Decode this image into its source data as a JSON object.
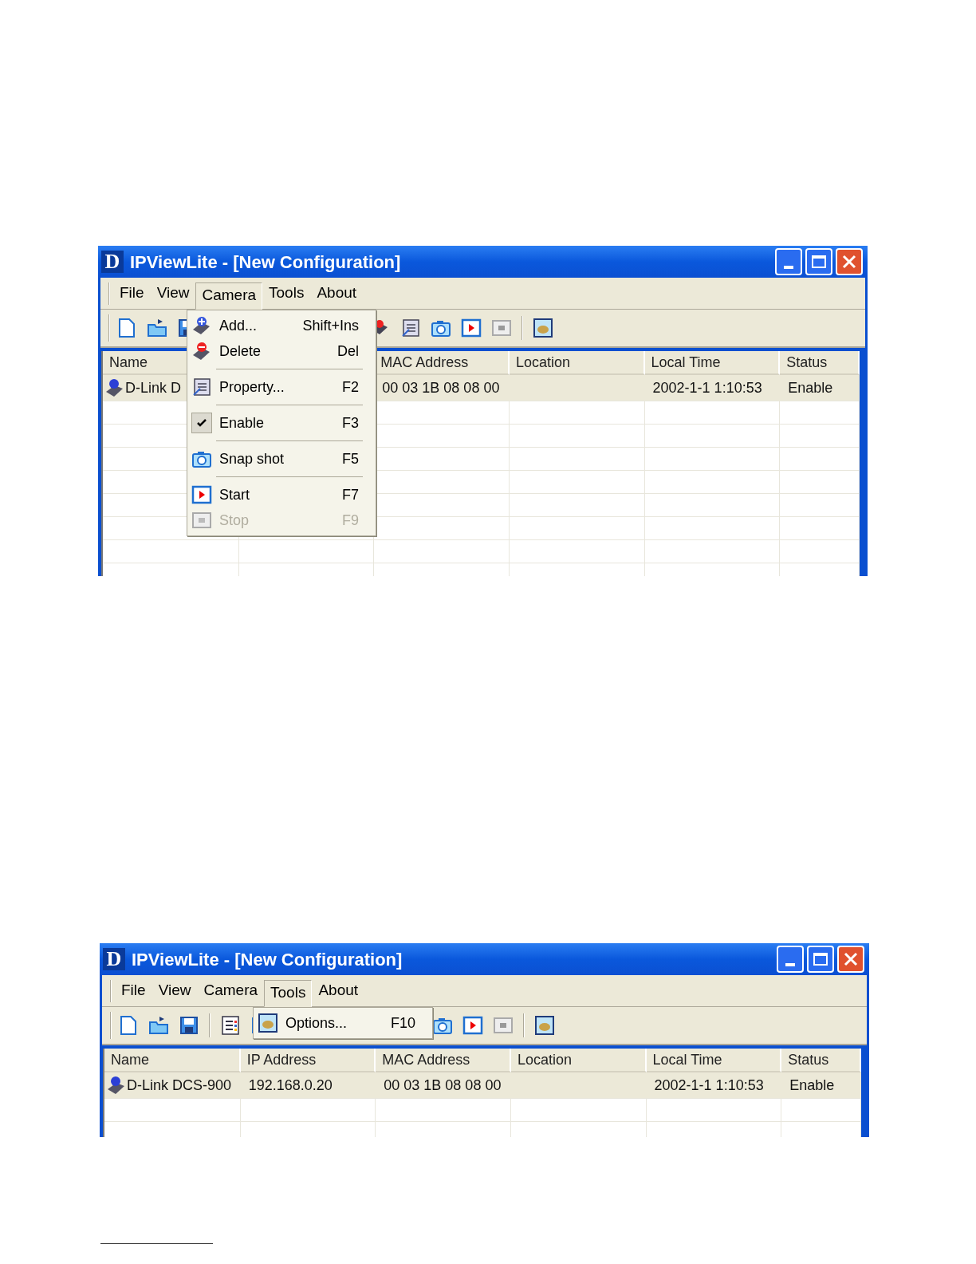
{
  "windows": [
    {
      "logo": "D",
      "title": "IPViewLite - [New Configuration]",
      "menu_bar": [
        {
          "label": "File",
          "selected": false
        },
        {
          "label": "View",
          "selected": false
        },
        {
          "label": "Camera",
          "selected": true
        },
        {
          "label": "Tools",
          "selected": false
        },
        {
          "label": "About",
          "selected": false
        }
      ],
      "toolbar": [
        {
          "kind": "new"
        },
        {
          "kind": "open"
        },
        {
          "kind": "save"
        },
        {
          "kind": "sep"
        },
        {
          "kind": "covered"
        },
        {
          "kind": "covered"
        },
        {
          "kind": "covered"
        },
        {
          "kind": "covered"
        },
        {
          "kind": "covered"
        },
        {
          "kind": "delete"
        },
        {
          "kind": "property"
        },
        {
          "kind": "snapshot"
        },
        {
          "kind": "start"
        },
        {
          "kind": "stop"
        },
        {
          "kind": "sep"
        },
        {
          "kind": "options"
        }
      ],
      "table": {
        "columns": [
          "Name",
          null,
          "MAC Address",
          "Location",
          "Local Time",
          "Status"
        ],
        "rows": [
          {
            "selected": true,
            "cells": [
              "D-Link D",
              null,
              "00 03 1B 08 08 00",
              null,
              "2002-1-1  1:10:53",
              "Enable"
            ]
          }
        ]
      },
      "menu": {
        "items": [
          {
            "kind": "add",
            "label": "Add...",
            "shortcut": "Shift+Ins",
            "checked": false,
            "disabled": false
          },
          {
            "kind": "delete",
            "label": "Delete",
            "shortcut": "Del",
            "checked": false,
            "disabled": false
          },
          {
            "kind": "separator"
          },
          {
            "kind": "property",
            "label": "Property...",
            "shortcut": "F2",
            "checked": false,
            "disabled": false
          },
          {
            "kind": "separator"
          },
          {
            "kind": "plain",
            "label": "Enable",
            "shortcut": "F3",
            "checked": true,
            "disabled": false
          },
          {
            "kind": "separator"
          },
          {
            "kind": "snapshot",
            "label": "Snap shot",
            "shortcut": "F5",
            "checked": false,
            "disabled": false
          },
          {
            "kind": "separator"
          },
          {
            "kind": "start",
            "label": "Start",
            "shortcut": "F7",
            "checked": false,
            "disabled": false
          },
          {
            "kind": "stop",
            "label": "Stop",
            "shortcut": "F9",
            "checked": false,
            "disabled": true
          }
        ]
      }
    },
    {
      "logo": "D",
      "title": "IPViewLite - [New Configuration]",
      "menu_bar": [
        {
          "label": "File",
          "selected": false
        },
        {
          "label": "View",
          "selected": false
        },
        {
          "label": "Camera",
          "selected": false
        },
        {
          "label": "Tools",
          "selected": true
        },
        {
          "label": "About",
          "selected": false
        }
      ],
      "toolbar": [
        {
          "kind": "new"
        },
        {
          "kind": "open"
        },
        {
          "kind": "save"
        },
        {
          "kind": "sep"
        },
        {
          "kind": "list"
        },
        {
          "kind": "window"
        },
        {
          "kind": "covered"
        },
        {
          "kind": "covered"
        },
        {
          "kind": "covered"
        },
        {
          "kind": "covered"
        },
        {
          "kind": "covered"
        },
        {
          "kind": "snapshot"
        },
        {
          "kind": "start"
        },
        {
          "kind": "stop"
        },
        {
          "kind": "sep"
        },
        {
          "kind": "options"
        }
      ],
      "table": {
        "columns": [
          "Name",
          "IP Address",
          "MAC Address",
          "Location",
          "Local Time",
          "Status"
        ],
        "rows": [
          {
            "selected": true,
            "cells": [
              "D-Link DCS-900",
              "192.168.0.20",
              "00 03 1B 08 08 00",
              null,
              "2002-1-1  1:10:53",
              "Enable"
            ]
          }
        ]
      },
      "menu": {
        "items": [
          {
            "kind": "options",
            "label": "Options...",
            "shortcut": "F10",
            "checked": false,
            "disabled": false
          }
        ]
      }
    }
  ]
}
